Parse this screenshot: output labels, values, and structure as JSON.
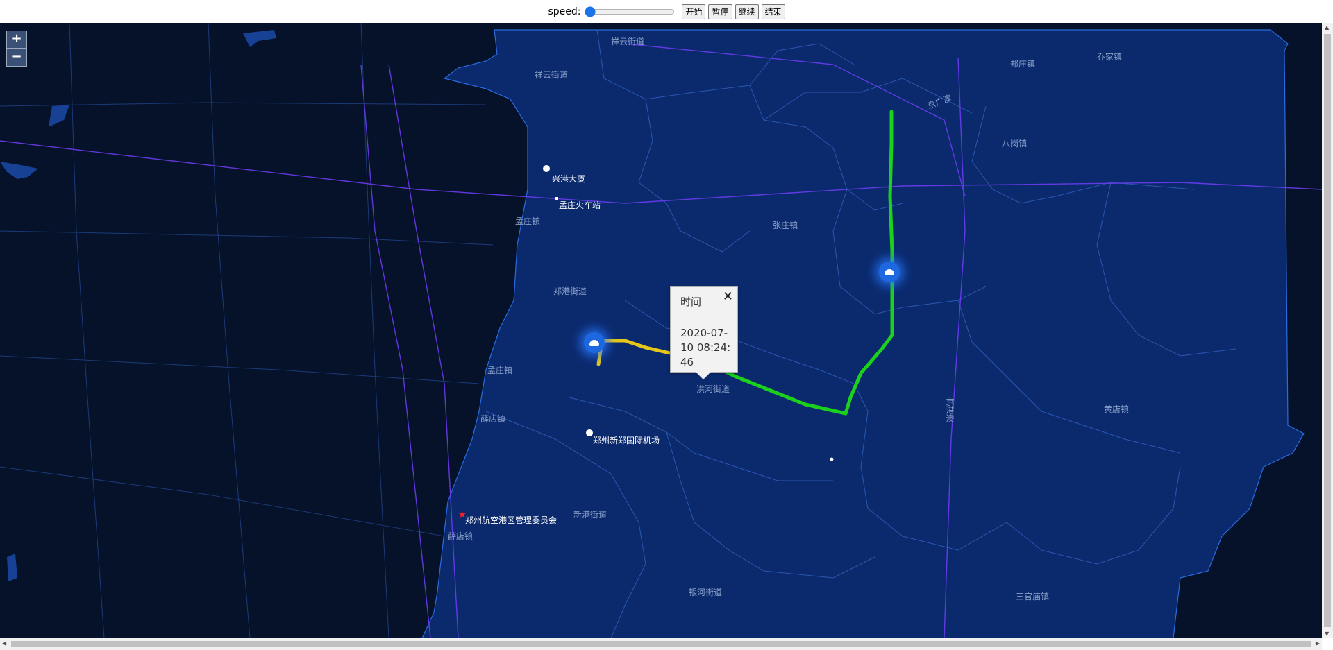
{
  "controls": {
    "speed_label": "speed:",
    "speed_value": 0,
    "start_label": "开始",
    "pause_label": "暂停",
    "resume_label": "继续",
    "end_label": "结束"
  },
  "zoom": {
    "in_label": "+",
    "out_label": "−"
  },
  "popup": {
    "title": "时间",
    "close_label": "✕",
    "value": "2020-07-10 08:24:46"
  },
  "places": {
    "xianggongjie": "祥云街道",
    "xiangyun": "祥云街道",
    "zhengzhuang": "郑庄镇",
    "qiaojiazhen": "乔家镇",
    "baganglu": "八岗镇",
    "zhangzhuang": "张庄镇",
    "menglu": "孟庄镇",
    "zhenggang": "郑港街道",
    "menglu2": "孟庄镇",
    "xuedian": "薛店镇",
    "honghe": "洪河街道",
    "xingang": "新港街道",
    "yinhe": "银河街道",
    "huangdian": "黄店镇",
    "sanguanmiao": "三官庙镇",
    "xuedian2": "薛店镇",
    "jingzhuyu": "京广澳",
    "anjing": "京港澳"
  },
  "pois": {
    "xinggang": "兴港大厦",
    "mengzhuang_station": "孟庄火车站",
    "airport": "郑州新郑国际机场",
    "committee": "郑州航空港区管理委员会"
  },
  "colors": {
    "map_bg": "#06122a",
    "district_fill": "#0b2a6e",
    "track_green": "#1bd11b",
    "track_yellow": "#e6c619",
    "marker_blue": "#1d67e0"
  },
  "icons": {
    "marker": "police-cap-icon",
    "vehicle": "vehicle-icon",
    "committee": "red-star-icon"
  }
}
